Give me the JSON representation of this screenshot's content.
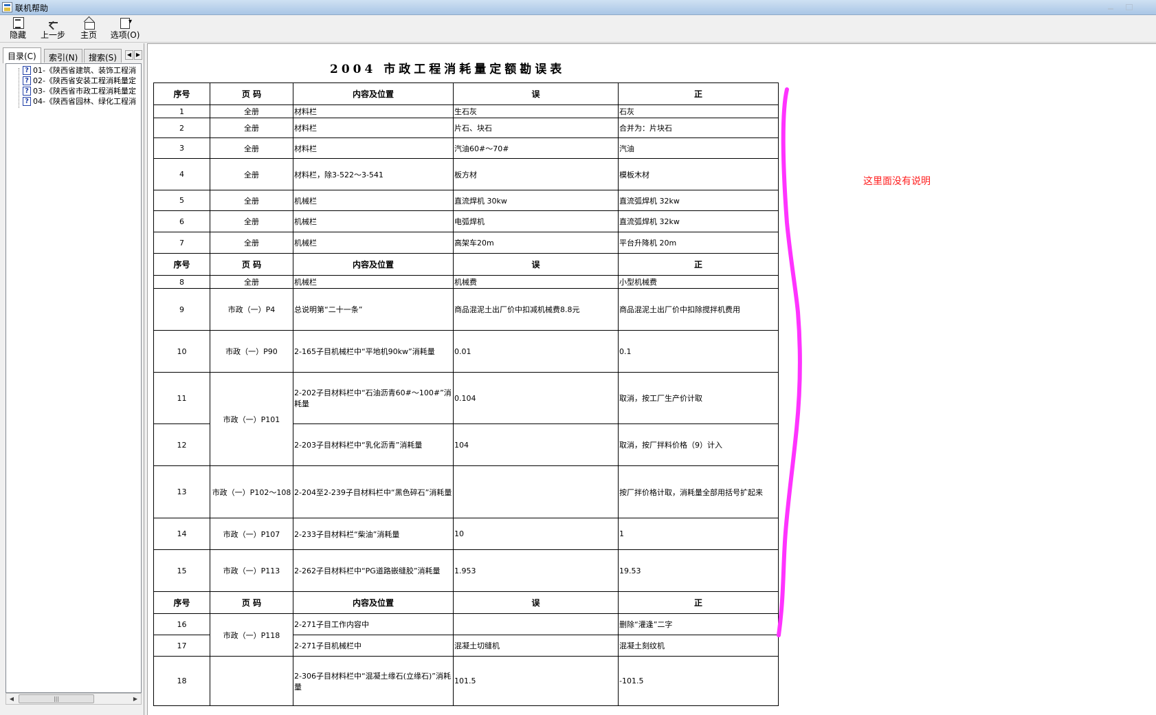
{
  "window": {
    "title": "联机帮助"
  },
  "toolbar": {
    "hide": "隐藏",
    "back": "上一步",
    "home": "主页",
    "options": "选项(O)"
  },
  "nav_tabs": [
    "目录(C)",
    "索引(N)",
    "搜索(S)"
  ],
  "tree_items": [
    "01-《陕西省建筑、装饰工程消",
    "02-《陕西省安装工程消耗量定",
    "03-《陕西省市政工程消耗量定",
    "04-《陕西省园林、绿化工程消"
  ],
  "document": {
    "title": "2004 市政工程消耗量定额勘误表",
    "headers": [
      "序号",
      "页 码",
      "内容及位置",
      "误",
      "正"
    ],
    "rows": [
      [
        "1",
        "全册",
        "材料栏",
        "生石灰",
        "石灰"
      ],
      [
        "2",
        "全册",
        "材料栏",
        "片石、块石",
        "合并为：片块石"
      ],
      [
        "3",
        "全册",
        "材料栏",
        "汽油60#～70#",
        "汽油"
      ],
      [
        "4",
        "全册",
        "材料栏，除3-522～3-541",
        "板方材",
        "模板木材"
      ],
      [
        "5",
        "全册",
        "机械栏",
        "直流焊机 30kw",
        "直流弧焊机 32kw"
      ],
      [
        "6",
        "全册",
        "机械栏",
        "电弧焊机",
        "直流弧焊机 32kw"
      ],
      [
        "7",
        "全册",
        "机械栏",
        "高架车20m",
        "平台升降机 20m"
      ],
      [
        "8",
        "全册",
        "机械栏",
        "机械费",
        "小型机械费"
      ],
      [
        "9",
        "市政（一）P4",
        "总说明第“二十一条”",
        "商品混泥土出厂价中扣减机械费8.8元",
        "商品混泥土出厂价中扣除搅拌机费用"
      ],
      [
        "10",
        "市政（一）P90",
        "2-165子目机械栏中“平地机90kw”消耗量",
        "0.01",
        "0.1"
      ],
      [
        "11",
        "市政（一）P101",
        "2-202子目材料栏中“石油沥青60#～100#”消耗量",
        "0.104",
        "取消，按工厂生产价计取"
      ],
      [
        "12",
        "",
        "2-203子目材料栏中“乳化沥青”消耗量",
        "104",
        "取消，按厂拌料价格（9）计入"
      ],
      [
        "13",
        "市政（一）P102～108",
        "2-204至2-239子目材料栏中“黑色碎石”消耗量",
        "",
        "按厂拌价格计取，消耗量全部用括号扩起来"
      ],
      [
        "14",
        "市政（一）P107",
        "2-233子目材料栏“柴油”消耗量",
        "10",
        "1"
      ],
      [
        "15",
        "市政（一）P113",
        "2-262子目材料栏中“PG道路嵌缝胶”消耗量",
        "1.953",
        "19.53"
      ],
      [
        "16",
        "市政（一）P118",
        "2-271子目工作内容中",
        "",
        "删除“灌逢”二字"
      ],
      [
        "17",
        "",
        "2-271子目机械栏中",
        "混凝土切缝机",
        "混凝土刻纹机"
      ],
      [
        "18",
        "",
        "2-306子目材料栏中“混凝土缘石(立缘石)”消耗量",
        "101.5",
        "-101.5"
      ]
    ]
  },
  "annotation": {
    "note": "这里面没有说明",
    "brace_color": "#ff33ff"
  }
}
